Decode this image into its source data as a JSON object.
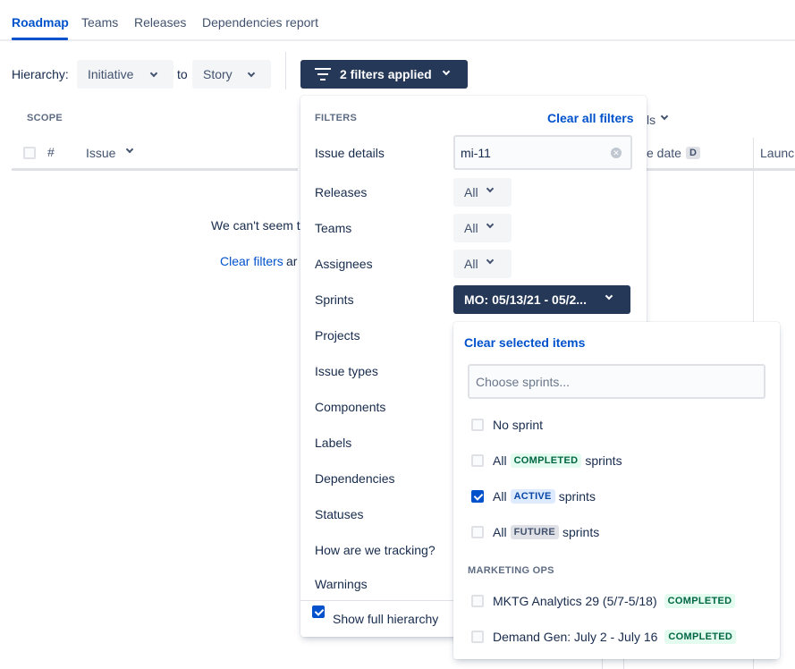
{
  "tabs": [
    "Roadmap",
    "Teams",
    "Releases",
    "Dependencies report"
  ],
  "toolbar": {
    "hierarchy_label": "Hierarchy:",
    "from_value": "Initiative",
    "to_label": "to",
    "to_value": "Story",
    "filters_button": "2 filters applied"
  },
  "table": {
    "scope_label": "SCOPE",
    "hash": "#",
    "issue_col": "Issue",
    "hidden_col_fragment": "ls",
    "date_col_fragment": "e date",
    "date_badge": "D",
    "launch_col_fragment": "Launc",
    "empty_msg_fragment": "We can't seem t",
    "clear_filters_link": "Clear filters",
    "clear_filters_suffix": " ar"
  },
  "filters_panel": {
    "title": "FILTERS",
    "clear_all": "Clear all filters",
    "issue_details_label": "Issue details",
    "issue_details_value": "mi-11",
    "rows": [
      "Releases",
      "Teams",
      "Assignees",
      "Sprints",
      "Projects",
      "Issue types",
      "Components",
      "Labels",
      "Dependencies",
      "Statuses",
      "How are we tracking?",
      "Warnings"
    ],
    "all_label": "All",
    "sprints_value": "MO: 05/13/21 - 05/2...",
    "show_full_hierarchy": "Show full hierarchy"
  },
  "sprint_dropdown": {
    "clear_selected": "Clear selected items",
    "search_placeholder": "Choose sprints...",
    "no_sprint": "No sprint",
    "all_word": "All",
    "sprints_word": "sprints",
    "completed_lozenge": "COMPLETED",
    "active_lozenge": "ACTIVE",
    "future_lozenge": "FUTURE",
    "group_title": "MARKETING OPS",
    "sprint_items": [
      {
        "name": "MKTG Analytics 29 (5/7-5/18)",
        "status": "COMPLETED"
      },
      {
        "name": "Demand Gen: July 2 - July 16",
        "status": "COMPLETED"
      }
    ]
  },
  "colors": {
    "accent": "#0052cc",
    "dark_button": "#253858",
    "text": "#172b4d"
  }
}
